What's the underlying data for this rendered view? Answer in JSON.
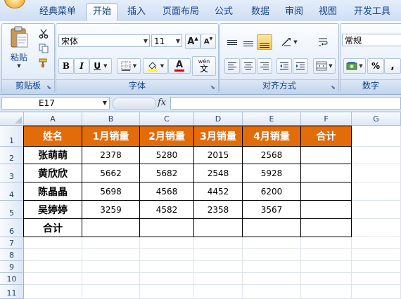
{
  "ribbon_tabs": [
    "经典菜单",
    "开始",
    "插入",
    "页面布局",
    "公式",
    "数据",
    "审阅",
    "视图",
    "开发工具"
  ],
  "active_tab": "开始",
  "clipboard": {
    "paste_label": "粘贴",
    "group_label": "剪贴板"
  },
  "font": {
    "name": "宋体",
    "size": "11",
    "group_label": "字体",
    "bold": "B",
    "italic": "I",
    "underline": "U",
    "grow": "A",
    "shrink": "A",
    "font_color_glyph": "A",
    "phonetic_glyph": "wén",
    "phonetic_char": "文"
  },
  "alignment": {
    "group_label": "对齐方式"
  },
  "number": {
    "format": "常规",
    "group_label": "数字",
    "percent": "%",
    "comma": ","
  },
  "formula_bar": {
    "name_box": "E17",
    "fx": "fx",
    "value": ""
  },
  "columns": [
    "A",
    "B",
    "C",
    "D",
    "E",
    "F",
    "G"
  ],
  "rows": [
    "1",
    "2",
    "3",
    "4",
    "5",
    "6",
    "7",
    "8",
    "9",
    "10",
    "11"
  ],
  "table": {
    "headers": [
      "姓名",
      "1月销量",
      "2月销量",
      "3月销量",
      "4月销量",
      "合计"
    ],
    "body": [
      [
        "张萌萌",
        "2378",
        "5280",
        "2015",
        "2568",
        ""
      ],
      [
        "黄欣欣",
        "5662",
        "5682",
        "2548",
        "5928",
        ""
      ],
      [
        "陈晶晶",
        "5698",
        "4568",
        "4452",
        "6200",
        ""
      ],
      [
        "吴婷婷",
        "3259",
        "4582",
        "2358",
        "3567",
        ""
      ],
      [
        "合计",
        "",
        "",
        "",
        "",
        ""
      ]
    ]
  },
  "colors": {
    "header_fill": "#e26b0a",
    "header_text": "#ffffff",
    "ribbon_blue": "#15428b"
  }
}
